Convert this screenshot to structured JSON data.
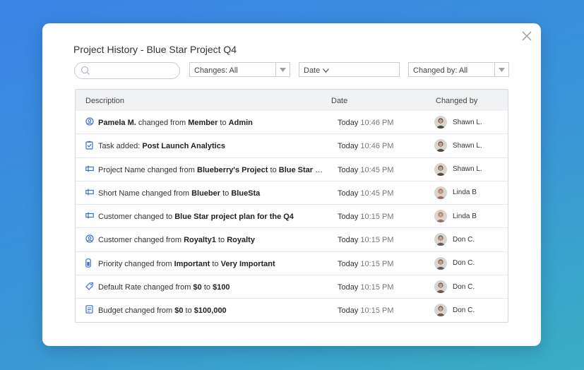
{
  "modal": {
    "title": "Project History - Blue Star Project Q4",
    "close_icon": "close-icon"
  },
  "filters": {
    "search_placeholder": "",
    "changes_label": "Changes: All",
    "date_label": "Date",
    "changed_by_label": "Changed by: All"
  },
  "table": {
    "headers": {
      "description": "Description",
      "date": "Date",
      "changed_by": "Changed by"
    },
    "rows": [
      {
        "icon": "user-circle-icon",
        "parts": [
          [
            "b",
            "Pamela M."
          ],
          [
            "t",
            " changed from "
          ],
          [
            "b",
            "Member"
          ],
          [
            "t",
            " to "
          ],
          [
            "b",
            "Admin"
          ]
        ],
        "day": "Today",
        "time": "10:46 PM",
        "user": "Shawn L.",
        "avatar_color": "#5a4a3c"
      },
      {
        "icon": "clipboard-check-icon",
        "parts": [
          [
            "t",
            "Task added: "
          ],
          [
            "b",
            "Post Launch Analytics"
          ]
        ],
        "day": "Today",
        "time": "10:46 PM",
        "user": "Shawn L.",
        "avatar_color": "#5a4a3c"
      },
      {
        "icon": "label-icon",
        "parts": [
          [
            "t",
            "Project Name changed from "
          ],
          [
            "b",
            "Blueberry's Project"
          ],
          [
            "t",
            " to "
          ],
          [
            "b",
            "Blue Star Proj..."
          ]
        ],
        "day": "Today",
        "time": "10:45 PM",
        "user": "Shawn L.",
        "avatar_color": "#5a4a3c"
      },
      {
        "icon": "label-icon",
        "parts": [
          [
            "t",
            "Short Name changed from "
          ],
          [
            "b",
            "Blueber"
          ],
          [
            "t",
            " to "
          ],
          [
            "b",
            "BlueSta"
          ]
        ],
        "day": "Today",
        "time": "10:45 PM",
        "user": "Linda B",
        "avatar_color": "#a0715a"
      },
      {
        "icon": "label-icon",
        "parts": [
          [
            "t",
            "Customer changed to "
          ],
          [
            "b",
            "Blue Star project plan for the Q4"
          ]
        ],
        "day": "Today",
        "time": "10:15 PM",
        "user": "Linda B",
        "avatar_color": "#a0715a"
      },
      {
        "icon": "user-circle-icon",
        "parts": [
          [
            "t",
            "Customer changed from "
          ],
          [
            "b",
            "Royalty1"
          ],
          [
            "t",
            " to "
          ],
          [
            "b",
            "Royalty"
          ]
        ],
        "day": "Today",
        "time": "10:15 PM",
        "user": "Don C.",
        "avatar_color": "#6b5a52"
      },
      {
        "icon": "priority-icon",
        "parts": [
          [
            "t",
            "Priority changed from "
          ],
          [
            "b",
            "Important"
          ],
          [
            "t",
            " to "
          ],
          [
            "b",
            "Very Important"
          ]
        ],
        "day": "Today",
        "time": "10:15 PM",
        "user": "Don C.",
        "avatar_color": "#6b5a52"
      },
      {
        "icon": "tag-icon",
        "parts": [
          [
            "t",
            "Default Rate changed from "
          ],
          [
            "b",
            "$0"
          ],
          [
            "t",
            " to "
          ],
          [
            "b",
            "$100"
          ]
        ],
        "day": "Today",
        "time": "10:15 PM",
        "user": "Don C.",
        "avatar_color": "#6b5a52"
      },
      {
        "icon": "budget-icon",
        "parts": [
          [
            "t",
            "Budget changed from "
          ],
          [
            "b",
            "$0"
          ],
          [
            "t",
            " to "
          ],
          [
            "b",
            "$100,000"
          ]
        ],
        "day": "Today",
        "time": "10:15 PM",
        "user": "Don C.",
        "avatar_color": "#6b5a52"
      }
    ]
  },
  "colors": {
    "accent_icon": "#3b6fd1",
    "border": "#c9ced6",
    "header_bg": "#f1f2f4"
  }
}
